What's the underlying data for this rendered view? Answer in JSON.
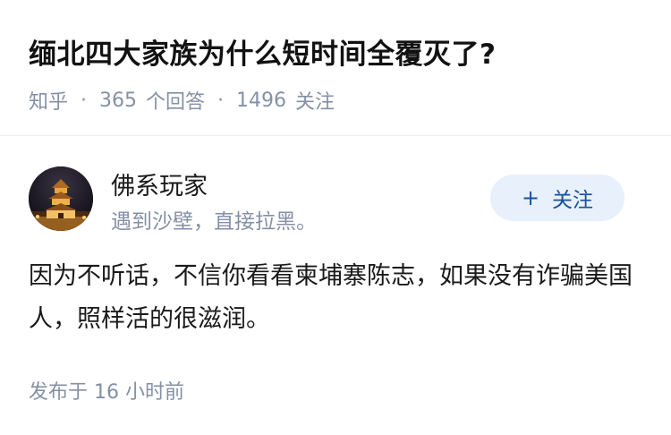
{
  "question": {
    "title": "缅北四大家族为什么短时间全覆灭了?",
    "source": "知乎",
    "separator": "·",
    "answer_count": "365",
    "answer_label": "个回答",
    "follow_count": "1496",
    "follow_label": "关注"
  },
  "author": {
    "name": "佛系玩家",
    "bio": "遇到沙壁，直接拉黑。",
    "avatar_icon": "avatar-bell-tower-night"
  },
  "follow_button": {
    "icon": "+",
    "label": "关注"
  },
  "answer": {
    "text": "因为不听话，不信你看看柬埔寨陈志，如果没有诈骗美国人，照样活的很滋润。",
    "time": "发布于 16 小时前"
  },
  "colors": {
    "meta_gray": "#8590a6",
    "accent_blue": "#175199",
    "button_bg": "#e8f0fb"
  }
}
